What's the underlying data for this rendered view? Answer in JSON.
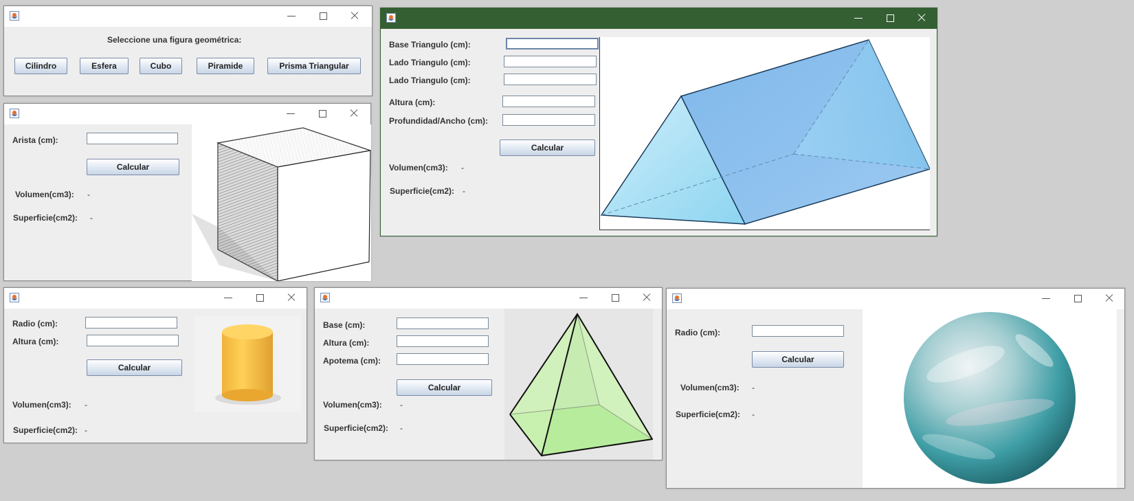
{
  "selector": {
    "prompt": "Seleccione una figura geométrica:",
    "buttons": [
      "Cilindro",
      "Esfera",
      "Cubo",
      "Piramide",
      "Prisma Triangular"
    ]
  },
  "cube": {
    "arista_label": "Arista (cm):",
    "calc": "Calcular",
    "vol_label": "Volumen(cm3):",
    "vol_value": "-",
    "sup_label": "Superficie(cm2):",
    "sup_value": "-"
  },
  "prism": {
    "base_label": "Base Triangulo (cm):",
    "lado1_label": "Lado Triangulo (cm):",
    "lado2_label": "Lado Triangulo (cm):",
    "altura_label": "Altura (cm):",
    "prof_label": "Profundidad/Ancho (cm):",
    "calc": "Calcular",
    "vol_label": "Volumen(cm3):",
    "vol_value": "-",
    "sup_label": "Superficie(cm2):",
    "sup_value": "-"
  },
  "cylinder": {
    "radio_label": "Radio (cm):",
    "altura_label": "Altura (cm):",
    "calc": "Calcular",
    "vol_label": "Volumen(cm3):",
    "vol_value": "-",
    "sup_label": "Superficie(cm2):",
    "sup_value": "-"
  },
  "pyramid": {
    "base_label": "Base (cm):",
    "altura_label": "Altura (cm):",
    "apotema_label": "Apotema (cm):",
    "calc": "Calcular",
    "vol_label": "Volumen(cm3):",
    "vol_value": "-",
    "sup_label": "Superficie(cm2):",
    "sup_value": "-"
  },
  "sphere": {
    "radio_label": "Radio (cm):",
    "calc": "Calcular",
    "vol_label": "Volumen(cm3):",
    "vol_value": "-",
    "sup_label": "Superficie(cm2):",
    "sup_value": "-"
  },
  "colors": {
    "active_titlebar": "#345f33",
    "button_gradient_bottom": "#c9d5e6"
  },
  "icons": [
    "java-icon",
    "minimize-icon",
    "maximize-icon",
    "close-icon"
  ]
}
